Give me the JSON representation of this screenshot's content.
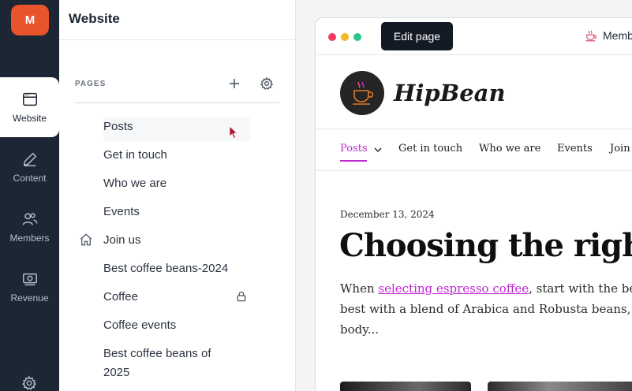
{
  "rail": {
    "avatar_letter": "M",
    "items": [
      {
        "label": "Website",
        "icon": "browser-icon"
      },
      {
        "label": "Content",
        "icon": "pen-icon"
      },
      {
        "label": "Members",
        "icon": "users-icon"
      },
      {
        "label": "Revenue",
        "icon": "money-icon"
      }
    ],
    "bottom_icon": "gear-icon"
  },
  "panel": {
    "title": "Website",
    "section_label": "PAGES",
    "add_icon": "plus-icon",
    "settings_icon": "gear-icon",
    "pages": [
      {
        "label": "Posts"
      },
      {
        "label": "Get in touch"
      },
      {
        "label": "Who we are"
      },
      {
        "label": "Events"
      },
      {
        "label": "Join us",
        "icon": "home-icon"
      },
      {
        "label": "Best coffee beans-2024"
      },
      {
        "label": "Coffee",
        "icon": "lock-icon"
      },
      {
        "label": "Coffee events"
      },
      {
        "label": "Best coffee beans of"
      },
      {
        "label": "2025"
      }
    ]
  },
  "preview": {
    "edit_button": "Edit page",
    "members_label": "Memb",
    "brand": "HipBean",
    "nav": [
      "Posts",
      "Get in touch",
      "Who we are",
      "Events",
      "Join"
    ],
    "date": "December 13, 2024",
    "title": "Choosing the right",
    "body_prefix": "When ",
    "body_link": "selecting espresso coffee",
    "body_line1_rest": ", start with the bean ty",
    "body_line2": "best with a blend of Arabica and Robusta beans, as th",
    "body_line3": "body..."
  },
  "colors": {
    "rail_bg": "#1d2634",
    "avatar": "#e8542b",
    "accent": "#c026d3",
    "edit_button_bg": "#131a26"
  }
}
